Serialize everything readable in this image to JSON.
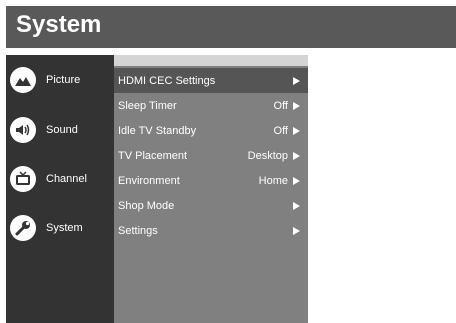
{
  "header": {
    "title": "System"
  },
  "sidebar": {
    "items": [
      {
        "label": "Picture",
        "icon": "picture-icon"
      },
      {
        "label": "Sound",
        "icon": "sound-icon"
      },
      {
        "label": "Channel",
        "icon": "channel-icon"
      },
      {
        "label": "System",
        "icon": "wrench-icon"
      }
    ]
  },
  "menu": {
    "items": [
      {
        "label": "HDMI CEC Settings",
        "value": ""
      },
      {
        "label": "Sleep Timer",
        "value": "Off"
      },
      {
        "label": "Idle TV Standby",
        "value": "Off"
      },
      {
        "label": "TV Placement",
        "value": "Desktop"
      },
      {
        "label": "Environment",
        "value": "Home"
      },
      {
        "label": "Shop Mode",
        "value": ""
      },
      {
        "label": "Settings",
        "value": ""
      }
    ]
  },
  "colors": {
    "title_bar": "#595959",
    "sidebar": "#333333",
    "panel": "#808080",
    "selected_row": "#555555"
  }
}
